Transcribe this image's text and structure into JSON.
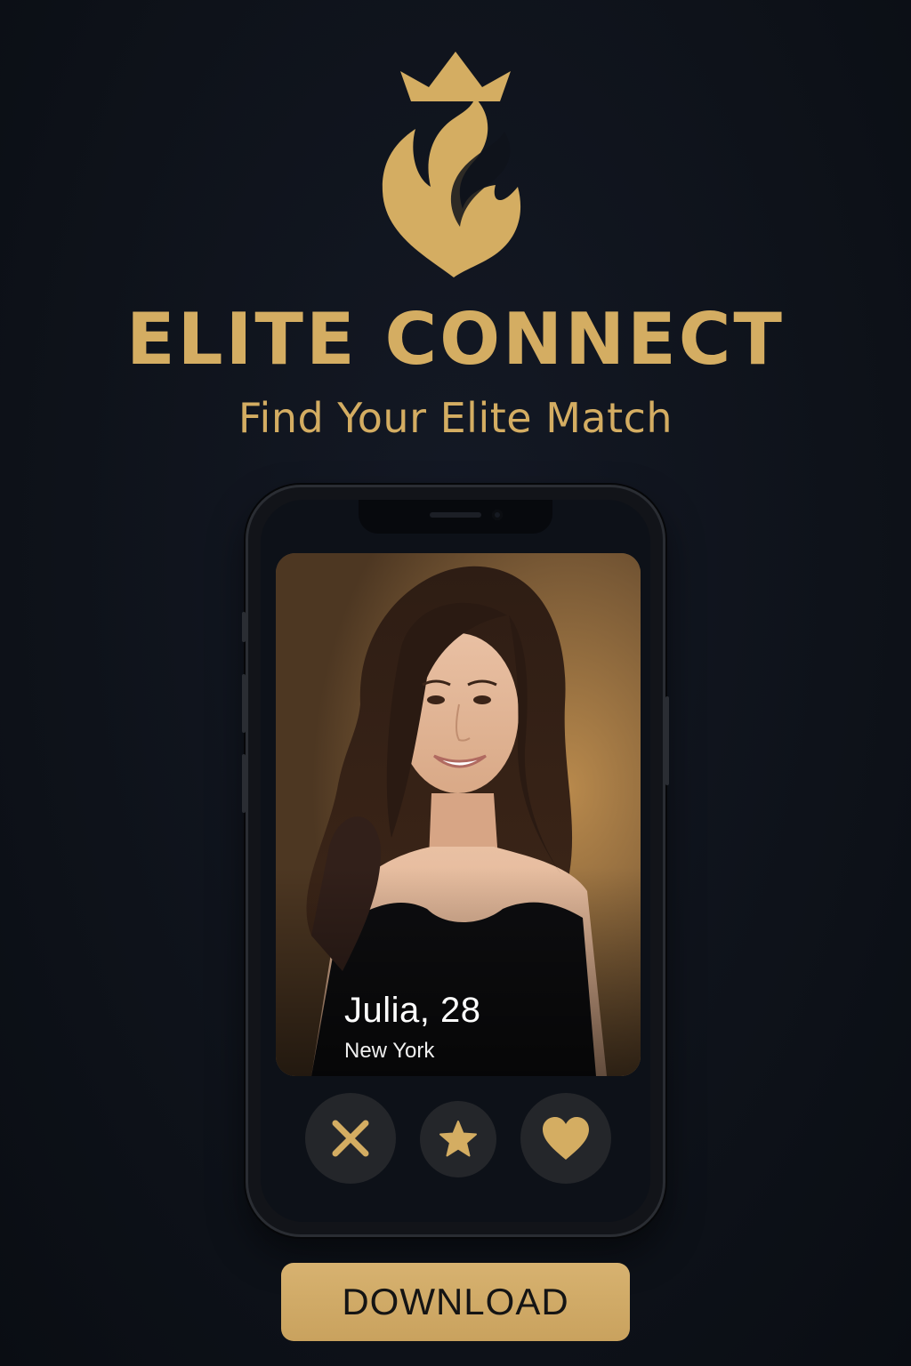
{
  "brand": {
    "name": "ELITE CONNECT",
    "tagline": "Find Your Elite Match",
    "logo_icon": "crown-flame-logo-icon",
    "accent_color": "#d4ad62"
  },
  "profile": {
    "name_age": "Julia, 28",
    "location": "New York",
    "photo": "woman-portrait-image"
  },
  "actions": {
    "dislike_icon": "close-icon",
    "superlike_icon": "star-icon",
    "like_icon": "heart-icon"
  },
  "cta": {
    "download_label": "DOWNLOAD"
  }
}
